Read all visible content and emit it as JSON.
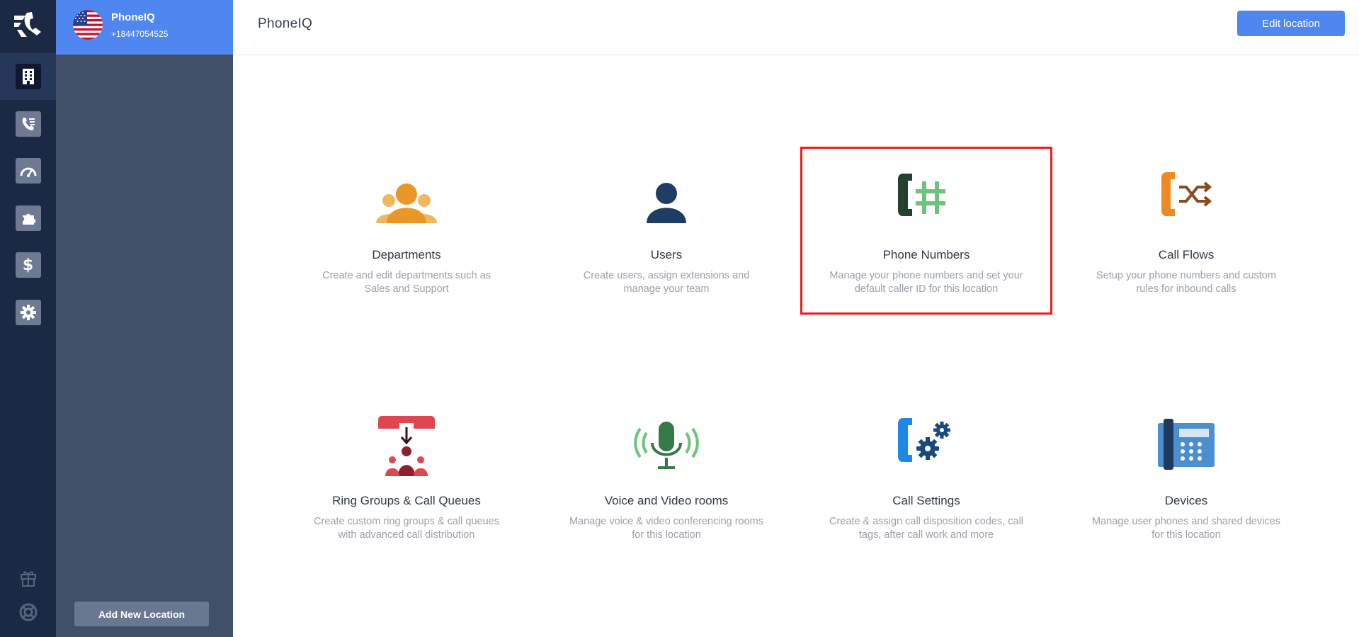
{
  "app": {
    "title": "PhoneIQ"
  },
  "header": {
    "edit_location_label": "Edit location"
  },
  "location": {
    "name": "PhoneIQ",
    "phone": "+18447054525"
  },
  "sidebar": {
    "add_location_label": "Add New Location"
  },
  "rail": {
    "items": [
      {
        "icon": "building-icon",
        "active": true
      },
      {
        "icon": "call-log-icon"
      },
      {
        "icon": "dashboard-gauge-icon"
      },
      {
        "icon": "puzzle-icon"
      },
      {
        "icon": "dollar-icon"
      },
      {
        "icon": "gear-icon"
      }
    ],
    "bottom": [
      {
        "icon": "gift-icon"
      },
      {
        "icon": "lifebuoy-icon"
      }
    ]
  },
  "cards": [
    {
      "title": "Departments",
      "desc_line1": "Create and edit departments such as",
      "desc_line2": "Sales and Support",
      "icon": "departments-icon"
    },
    {
      "title": "Users",
      "desc_line1": "Create users, assign extensions and",
      "desc_line2": "manage your team",
      "icon": "user-icon"
    },
    {
      "title": "Phone Numbers",
      "desc_line1": "Manage your phone numbers and set your",
      "desc_line2": "default caller ID for this location",
      "icon": "phone-hash-icon",
      "highlighted": true
    },
    {
      "title": "Call Flows",
      "desc_line1": "Setup your phone numbers and custom",
      "desc_line2": "rules for inbound calls",
      "icon": "call-flow-icon"
    },
    {
      "title": "Ring Groups & Call Queues",
      "desc_line1": "Create custom ring groups & call queues",
      "desc_line2": "with advanced call distribution",
      "icon": "ring-group-icon"
    },
    {
      "title": "Voice and Video rooms",
      "desc_line1": "Manage voice & video conferencing rooms",
      "desc_line2": "for this location",
      "icon": "microphone-icon"
    },
    {
      "title": "Call Settings",
      "desc_line1": "Create & assign call disposition codes, call",
      "desc_line2": "tags, after call work and more",
      "icon": "call-settings-icon"
    },
    {
      "title": "Devices",
      "desc_line1": "Manage user phones and shared devices",
      "desc_line2": "for this location",
      "icon": "desk-phone-icon"
    }
  ],
  "colors": {
    "rail": "#1c2945",
    "panel": "#415068",
    "accent": "#4f86f0",
    "highlight": "#ee1c1c"
  }
}
